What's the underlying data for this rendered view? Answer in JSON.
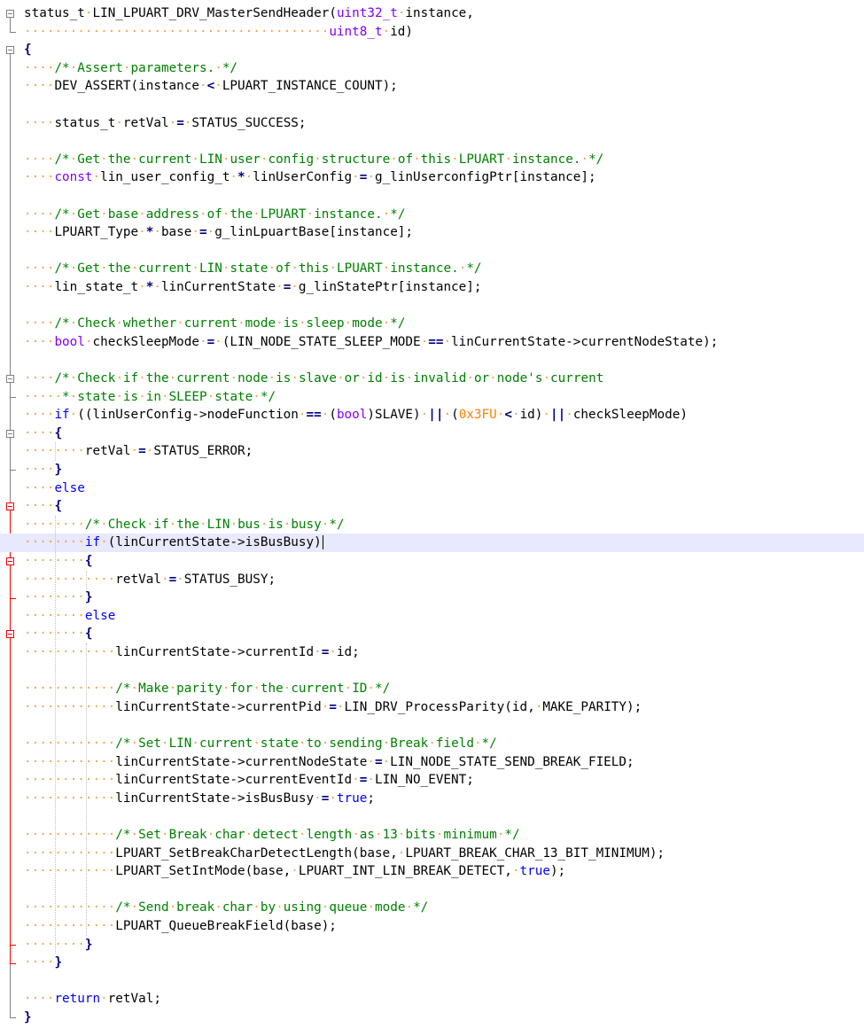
{
  "editor": {
    "colors": {
      "background": "#ffffff",
      "current_line": "#e8e8ff",
      "whitespace_dot": "#f5a146",
      "keyword": "#0000ff",
      "comment": "#008000",
      "type": "#8000ff",
      "number": "#ff8000",
      "operator": "#000080",
      "fold_marker": "#808080",
      "active_fold_marker": "#ff0000"
    },
    "current_line": 29,
    "lines": [
      {
        "tokens": [
          {
            "t": "tx",
            "v": "status_t LIN_LPUART_DRV_MasterSendHeader("
          },
          {
            "t": "ty",
            "v": "uint32_t"
          },
          {
            "t": "tx",
            "v": " instance,"
          }
        ]
      },
      {
        "tokens": [
          {
            "t": "ws",
            "v": "                                        "
          },
          {
            "t": "ty",
            "v": "uint8_t"
          },
          {
            "t": "tx",
            "v": " id)"
          }
        ]
      },
      {
        "tokens": [
          {
            "t": "op",
            "v": "{"
          }
        ]
      },
      {
        "tokens": [
          {
            "t": "ws",
            "v": "    "
          },
          {
            "t": "cm",
            "v": "/* Assert parameters. */"
          }
        ]
      },
      {
        "tokens": [
          {
            "t": "ws",
            "v": "    "
          },
          {
            "t": "tx",
            "v": "DEV_ASSERT(instance "
          },
          {
            "t": "op",
            "v": "<"
          },
          {
            "t": "tx",
            "v": " LPUART_INSTANCE_COUNT);"
          }
        ]
      },
      {
        "tokens": []
      },
      {
        "tokens": [
          {
            "t": "ws",
            "v": "    "
          },
          {
            "t": "tx",
            "v": "status_t retVal "
          },
          {
            "t": "op",
            "v": "="
          },
          {
            "t": "tx",
            "v": " STATUS_SUCCESS;"
          }
        ]
      },
      {
        "tokens": []
      },
      {
        "tokens": [
          {
            "t": "ws",
            "v": "    "
          },
          {
            "t": "cm",
            "v": "/* Get the current LIN user config structure of this LPUART instance. */"
          }
        ]
      },
      {
        "tokens": [
          {
            "t": "ws",
            "v": "    "
          },
          {
            "t": "ty",
            "v": "const"
          },
          {
            "t": "tx",
            "v": " lin_user_config_t "
          },
          {
            "t": "op",
            "v": "*"
          },
          {
            "t": "tx",
            "v": " linUserConfig "
          },
          {
            "t": "op",
            "v": "="
          },
          {
            "t": "tx",
            "v": " g_linUserconfigPtr[instance];"
          }
        ]
      },
      {
        "tokens": []
      },
      {
        "tokens": [
          {
            "t": "ws",
            "v": "    "
          },
          {
            "t": "cm",
            "v": "/* Get base address of the LPUART instance. */"
          }
        ]
      },
      {
        "tokens": [
          {
            "t": "ws",
            "v": "    "
          },
          {
            "t": "tx",
            "v": "LPUART_Type "
          },
          {
            "t": "op",
            "v": "*"
          },
          {
            "t": "tx",
            "v": " base "
          },
          {
            "t": "op",
            "v": "="
          },
          {
            "t": "tx",
            "v": " g_linLpuartBase[instance];"
          }
        ]
      },
      {
        "tokens": []
      },
      {
        "tokens": [
          {
            "t": "ws",
            "v": "    "
          },
          {
            "t": "cm",
            "v": "/* Get the current LIN state of this LPUART instance. */"
          }
        ]
      },
      {
        "tokens": [
          {
            "t": "ws",
            "v": "    "
          },
          {
            "t": "tx",
            "v": "lin_state_t "
          },
          {
            "t": "op",
            "v": "*"
          },
          {
            "t": "tx",
            "v": " linCurrentState "
          },
          {
            "t": "op",
            "v": "="
          },
          {
            "t": "tx",
            "v": " g_linStatePtr[instance];"
          }
        ]
      },
      {
        "tokens": []
      },
      {
        "tokens": [
          {
            "t": "ws",
            "v": "    "
          },
          {
            "t": "cm",
            "v": "/* Check whether current mode is sleep mode */"
          }
        ]
      },
      {
        "tokens": [
          {
            "t": "ws",
            "v": "    "
          },
          {
            "t": "ty",
            "v": "bool"
          },
          {
            "t": "tx",
            "v": " checkSleepMode "
          },
          {
            "t": "op",
            "v": "="
          },
          {
            "t": "tx",
            "v": " (LIN_NODE_STATE_SLEEP_MODE "
          },
          {
            "t": "op",
            "v": "=="
          },
          {
            "t": "tx",
            "v": " linCurrentState->currentNodeState);"
          }
        ]
      },
      {
        "tokens": []
      },
      {
        "tokens": [
          {
            "t": "ws",
            "v": "    "
          },
          {
            "t": "cm",
            "v": "/* Check if the current node is slave or id is invalid or node's current"
          }
        ]
      },
      {
        "tokens": [
          {
            "t": "ws",
            "v": "     "
          },
          {
            "t": "cm",
            "v": "* state is in SLEEP state */"
          }
        ]
      },
      {
        "tokens": [
          {
            "t": "ws",
            "v": "    "
          },
          {
            "t": "kw",
            "v": "if"
          },
          {
            "t": "tx",
            "v": " ((linUserConfig->nodeFunction "
          },
          {
            "t": "op",
            "v": "=="
          },
          {
            "t": "tx",
            "v": " ("
          },
          {
            "t": "ty",
            "v": "bool"
          },
          {
            "t": "tx",
            "v": ")SLAVE) "
          },
          {
            "t": "op",
            "v": "||"
          },
          {
            "t": "tx",
            "v": " ("
          },
          {
            "t": "num",
            "v": "0x3FU"
          },
          {
            "t": "tx",
            "v": " "
          },
          {
            "t": "op",
            "v": "<"
          },
          {
            "t": "tx",
            "v": " id) "
          },
          {
            "t": "op",
            "v": "||"
          },
          {
            "t": "tx",
            "v": " checkSleepMode)"
          }
        ]
      },
      {
        "tokens": [
          {
            "t": "ws",
            "v": "    "
          },
          {
            "t": "op",
            "v": "{"
          }
        ]
      },
      {
        "tokens": [
          {
            "t": "ws",
            "v": "        "
          },
          {
            "t": "tx",
            "v": "retVal "
          },
          {
            "t": "op",
            "v": "="
          },
          {
            "t": "tx",
            "v": " STATUS_ERROR;"
          }
        ]
      },
      {
        "tokens": [
          {
            "t": "ws",
            "v": "    "
          },
          {
            "t": "op",
            "v": "}"
          }
        ]
      },
      {
        "tokens": [
          {
            "t": "ws",
            "v": "    "
          },
          {
            "t": "kw",
            "v": "else"
          }
        ]
      },
      {
        "tokens": [
          {
            "t": "ws",
            "v": "    "
          },
          {
            "t": "op",
            "v": "{"
          }
        ]
      },
      {
        "tokens": [
          {
            "t": "ws",
            "v": "        "
          },
          {
            "t": "cm",
            "v": "/* Check if the LIN bus is busy */"
          }
        ]
      },
      {
        "tokens": [
          {
            "t": "ws",
            "v": "        "
          },
          {
            "t": "kw",
            "v": "if"
          },
          {
            "t": "tx",
            "v": " (linCurrentState->isBusBusy)"
          }
        ]
      },
      {
        "tokens": [
          {
            "t": "ws",
            "v": "        "
          },
          {
            "t": "op",
            "v": "{"
          }
        ]
      },
      {
        "tokens": [
          {
            "t": "ws",
            "v": "            "
          },
          {
            "t": "tx",
            "v": "retVal "
          },
          {
            "t": "op",
            "v": "="
          },
          {
            "t": "tx",
            "v": " STATUS_BUSY;"
          }
        ]
      },
      {
        "tokens": [
          {
            "t": "ws",
            "v": "        "
          },
          {
            "t": "op",
            "v": "}"
          }
        ]
      },
      {
        "tokens": [
          {
            "t": "ws",
            "v": "        "
          },
          {
            "t": "kw",
            "v": "else"
          }
        ]
      },
      {
        "tokens": [
          {
            "t": "ws",
            "v": "        "
          },
          {
            "t": "op",
            "v": "{"
          }
        ]
      },
      {
        "tokens": [
          {
            "t": "ws",
            "v": "            "
          },
          {
            "t": "tx",
            "v": "linCurrentState->currentId "
          },
          {
            "t": "op",
            "v": "="
          },
          {
            "t": "tx",
            "v": " id;"
          }
        ]
      },
      {
        "tokens": []
      },
      {
        "tokens": [
          {
            "t": "ws",
            "v": "            "
          },
          {
            "t": "cm",
            "v": "/* Make parity for the current ID */"
          }
        ]
      },
      {
        "tokens": [
          {
            "t": "ws",
            "v": "            "
          },
          {
            "t": "tx",
            "v": "linCurrentState->currentPid "
          },
          {
            "t": "op",
            "v": "="
          },
          {
            "t": "tx",
            "v": " LIN_DRV_ProcessParity(id, MAKE_PARITY);"
          }
        ]
      },
      {
        "tokens": []
      },
      {
        "tokens": [
          {
            "t": "ws",
            "v": "            "
          },
          {
            "t": "cm",
            "v": "/* Set LIN current state to sending Break field */"
          }
        ]
      },
      {
        "tokens": [
          {
            "t": "ws",
            "v": "            "
          },
          {
            "t": "tx",
            "v": "linCurrentState->currentNodeState "
          },
          {
            "t": "op",
            "v": "="
          },
          {
            "t": "tx",
            "v": " LIN_NODE_STATE_SEND_BREAK_FIELD;"
          }
        ]
      },
      {
        "tokens": [
          {
            "t": "ws",
            "v": "            "
          },
          {
            "t": "tx",
            "v": "linCurrentState->currentEventId "
          },
          {
            "t": "op",
            "v": "="
          },
          {
            "t": "tx",
            "v": " LIN_NO_EVENT;"
          }
        ]
      },
      {
        "tokens": [
          {
            "t": "ws",
            "v": "            "
          },
          {
            "t": "tx",
            "v": "linCurrentState->isBusBusy "
          },
          {
            "t": "op",
            "v": "="
          },
          {
            "t": "tx",
            "v": " "
          },
          {
            "t": "kw",
            "v": "true"
          },
          {
            "t": "tx",
            "v": ";"
          }
        ]
      },
      {
        "tokens": []
      },
      {
        "tokens": [
          {
            "t": "ws",
            "v": "            "
          },
          {
            "t": "cm",
            "v": "/* Set Break char detect length as 13 bits minimum */"
          }
        ]
      },
      {
        "tokens": [
          {
            "t": "ws",
            "v": "            "
          },
          {
            "t": "tx",
            "v": "LPUART_SetBreakCharDetectLength(base, LPUART_BREAK_CHAR_13_BIT_MINIMUM);"
          }
        ]
      },
      {
        "tokens": [
          {
            "t": "ws",
            "v": "            "
          },
          {
            "t": "tx",
            "v": "LPUART_SetIntMode(base, LPUART_INT_LIN_BREAK_DETECT, "
          },
          {
            "t": "kw",
            "v": "true"
          },
          {
            "t": "tx",
            "v": ");"
          }
        ]
      },
      {
        "tokens": []
      },
      {
        "tokens": [
          {
            "t": "ws",
            "v": "            "
          },
          {
            "t": "cm",
            "v": "/* Send break char by using queue mode */"
          }
        ]
      },
      {
        "tokens": [
          {
            "t": "ws",
            "v": "            "
          },
          {
            "t": "tx",
            "v": "LPUART_QueueBreakField(base);"
          }
        ]
      },
      {
        "tokens": [
          {
            "t": "ws",
            "v": "        "
          },
          {
            "t": "op",
            "v": "}"
          }
        ]
      },
      {
        "tokens": [
          {
            "t": "ws",
            "v": "    "
          },
          {
            "t": "op",
            "v": "}"
          }
        ]
      },
      {
        "tokens": []
      },
      {
        "tokens": [
          {
            "t": "ws",
            "v": "    "
          },
          {
            "t": "kw",
            "v": "return"
          },
          {
            "t": "tx",
            "v": " retVal;"
          }
        ]
      },
      {
        "tokens": [
          {
            "t": "op",
            "v": "}"
          }
        ]
      }
    ],
    "folds": [
      {
        "kind": "box",
        "line": 0
      },
      {
        "kind": "end",
        "line": 1
      },
      {
        "kind": "box",
        "line": 2
      },
      {
        "kind": "box",
        "line": 20
      },
      {
        "kind": "end",
        "line": 21
      },
      {
        "kind": "box",
        "line": 23
      },
      {
        "kind": "end",
        "line": 25
      },
      {
        "kind": "box",
        "line": 27,
        "active": true
      },
      {
        "kind": "box",
        "line": 30,
        "active": true
      },
      {
        "kind": "end",
        "line": 32,
        "active": true
      },
      {
        "kind": "box",
        "line": 34,
        "active": true
      },
      {
        "kind": "end",
        "line": 51,
        "active": true
      },
      {
        "kind": "end",
        "line": 52,
        "active": true
      },
      {
        "kind": "end",
        "line": 55
      }
    ]
  }
}
